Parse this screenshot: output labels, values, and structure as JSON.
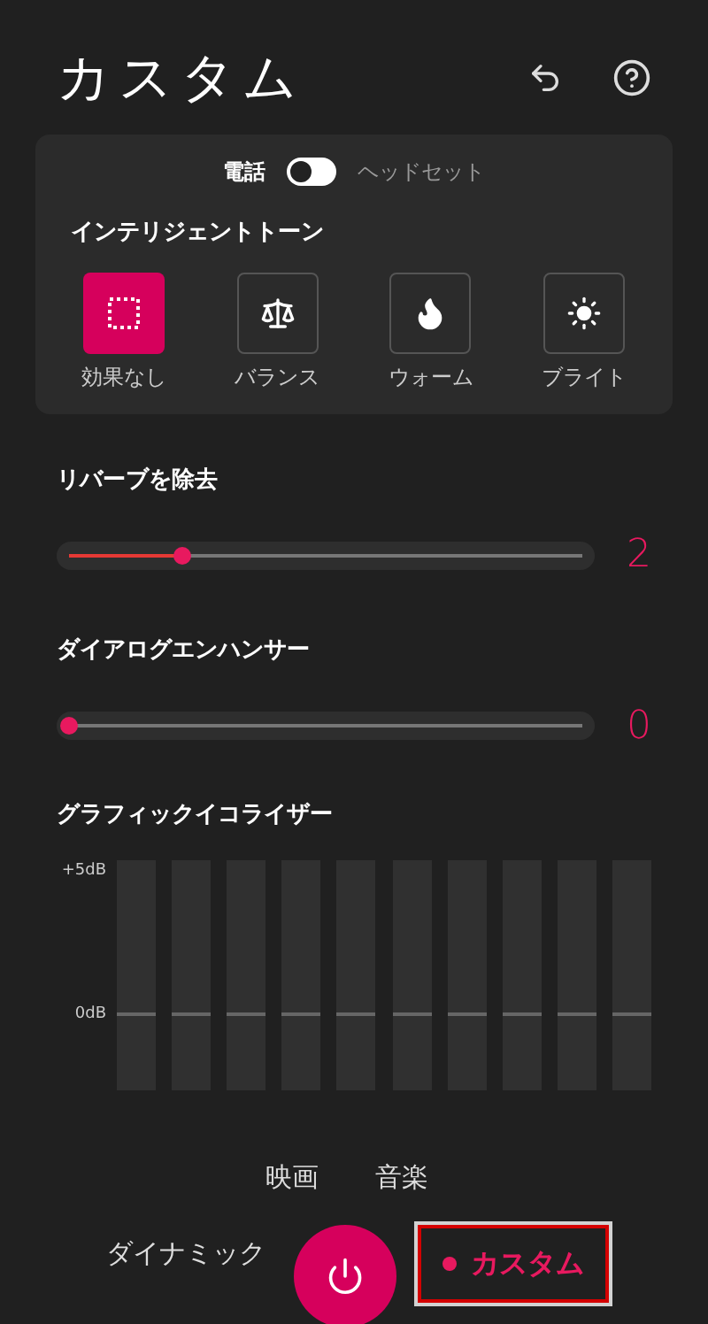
{
  "header": {
    "title": "カスタム"
  },
  "output": {
    "left_label": "電話",
    "right_label": "ヘッドセット",
    "on": false
  },
  "intelligent_tone": {
    "title": "インテリジェントトーン",
    "options": [
      {
        "label": "効果なし",
        "kind": "none",
        "selected": true
      },
      {
        "label": "バランス",
        "kind": "balance",
        "selected": false
      },
      {
        "label": "ウォーム",
        "kind": "warm",
        "selected": false
      },
      {
        "label": "ブライト",
        "kind": "bright",
        "selected": false
      }
    ]
  },
  "sliders": [
    {
      "title": "リバーブを除去",
      "level": 0.22,
      "reading": "2"
    },
    {
      "title": "ダイアログエンハンサー",
      "level": 0,
      "reading": "0"
    }
  ],
  "equalizer": {
    "title": "グラフィックイコライザー",
    "top_label": "+5dB",
    "zero_label": "0dB",
    "bands": [
      {
        "level": 0.32
      },
      {
        "level": 0.32
      },
      {
        "level": 0.32
      },
      {
        "level": 0.32
      },
      {
        "level": 0.32
      },
      {
        "level": 0.32
      },
      {
        "level": 0.32
      },
      {
        "level": 0.32
      },
      {
        "level": 0.32
      },
      {
        "level": 0.32
      }
    ]
  },
  "modes": [
    {
      "label": "映画",
      "selected": false
    },
    {
      "label": "音楽",
      "selected": false
    },
    {
      "label": "ダイナミック",
      "selected": false
    },
    {
      "label": "カスタム",
      "selected": true
    }
  ]
}
